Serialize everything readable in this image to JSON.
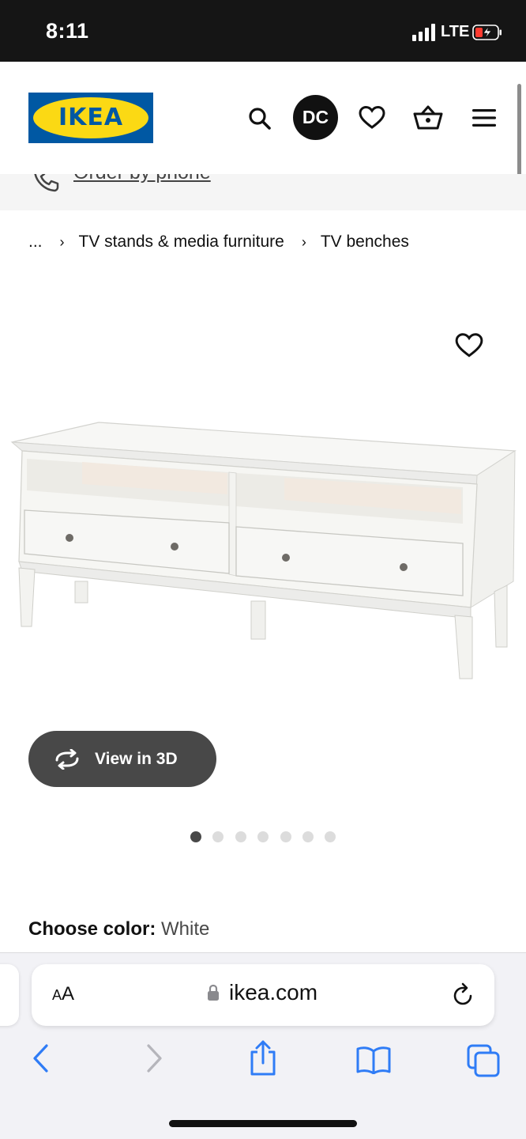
{
  "status_bar": {
    "time": "8:11",
    "network": "LTE"
  },
  "header": {
    "logo_text": "IKEA",
    "avatar_initials": "DC",
    "icons": [
      "search-icon",
      "heart-icon",
      "cart-icon",
      "menu-icon"
    ]
  },
  "phone_strip": {
    "label": "Order by phone"
  },
  "breadcrumb": {
    "ellipsis": "...",
    "items": [
      "TV stands & media furniture",
      "TV benches"
    ]
  },
  "product": {
    "view_3d_label": "View in 3D",
    "image_count": 7,
    "active_image_index": 0
  },
  "color_selector": {
    "label": "Choose color:",
    "value": "White"
  },
  "browser": {
    "aa_label_small": "A",
    "aa_label_large": "A",
    "url": "ikea.com",
    "colors": {
      "accent": "#2f7cf6",
      "disabled": "#b5b5bb"
    }
  }
}
